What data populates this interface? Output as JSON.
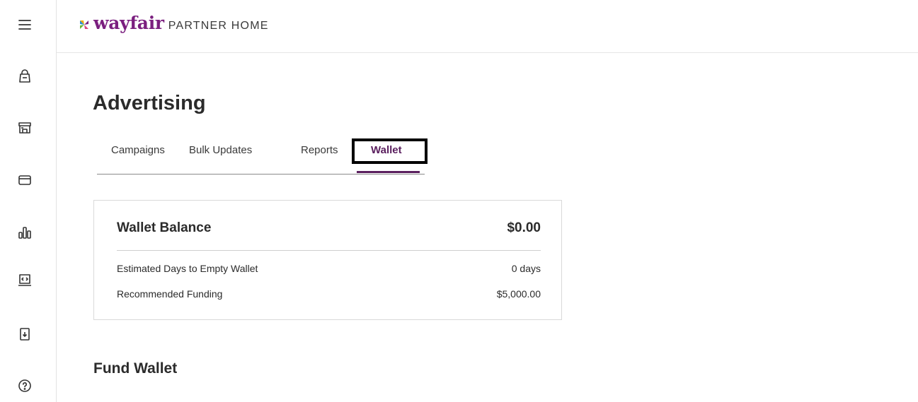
{
  "header": {
    "brand": "wayfair",
    "subtitle": "PARTNER HOME"
  },
  "sidebar": {
    "items": [
      {
        "name": "menu-icon"
      },
      {
        "name": "shopping-bag-icon"
      },
      {
        "name": "storefront-icon"
      },
      {
        "name": "credit-card-icon"
      },
      {
        "name": "bar-chart-icon"
      },
      {
        "name": "developer-code-icon"
      },
      {
        "name": "document-download-icon"
      },
      {
        "name": "help-icon"
      }
    ]
  },
  "main": {
    "title": "Advertising",
    "tabs": [
      {
        "label": "Campaigns",
        "active": false
      },
      {
        "label": "Bulk Updates",
        "active": false
      },
      {
        "label": "Reports",
        "active": false
      },
      {
        "label": "Wallet",
        "active": true
      }
    ],
    "wallet_card": {
      "title": "Wallet Balance",
      "balance": "$0.00",
      "rows": [
        {
          "label": "Estimated Days to Empty Wallet",
          "value": "0 days"
        },
        {
          "label": "Recommended Funding",
          "value": "$5,000.00"
        }
      ]
    },
    "fund_section_title": "Fund Wallet"
  },
  "colors": {
    "brand_purple": "#7b1f7f",
    "active_tab": "#5a1f5e"
  }
}
